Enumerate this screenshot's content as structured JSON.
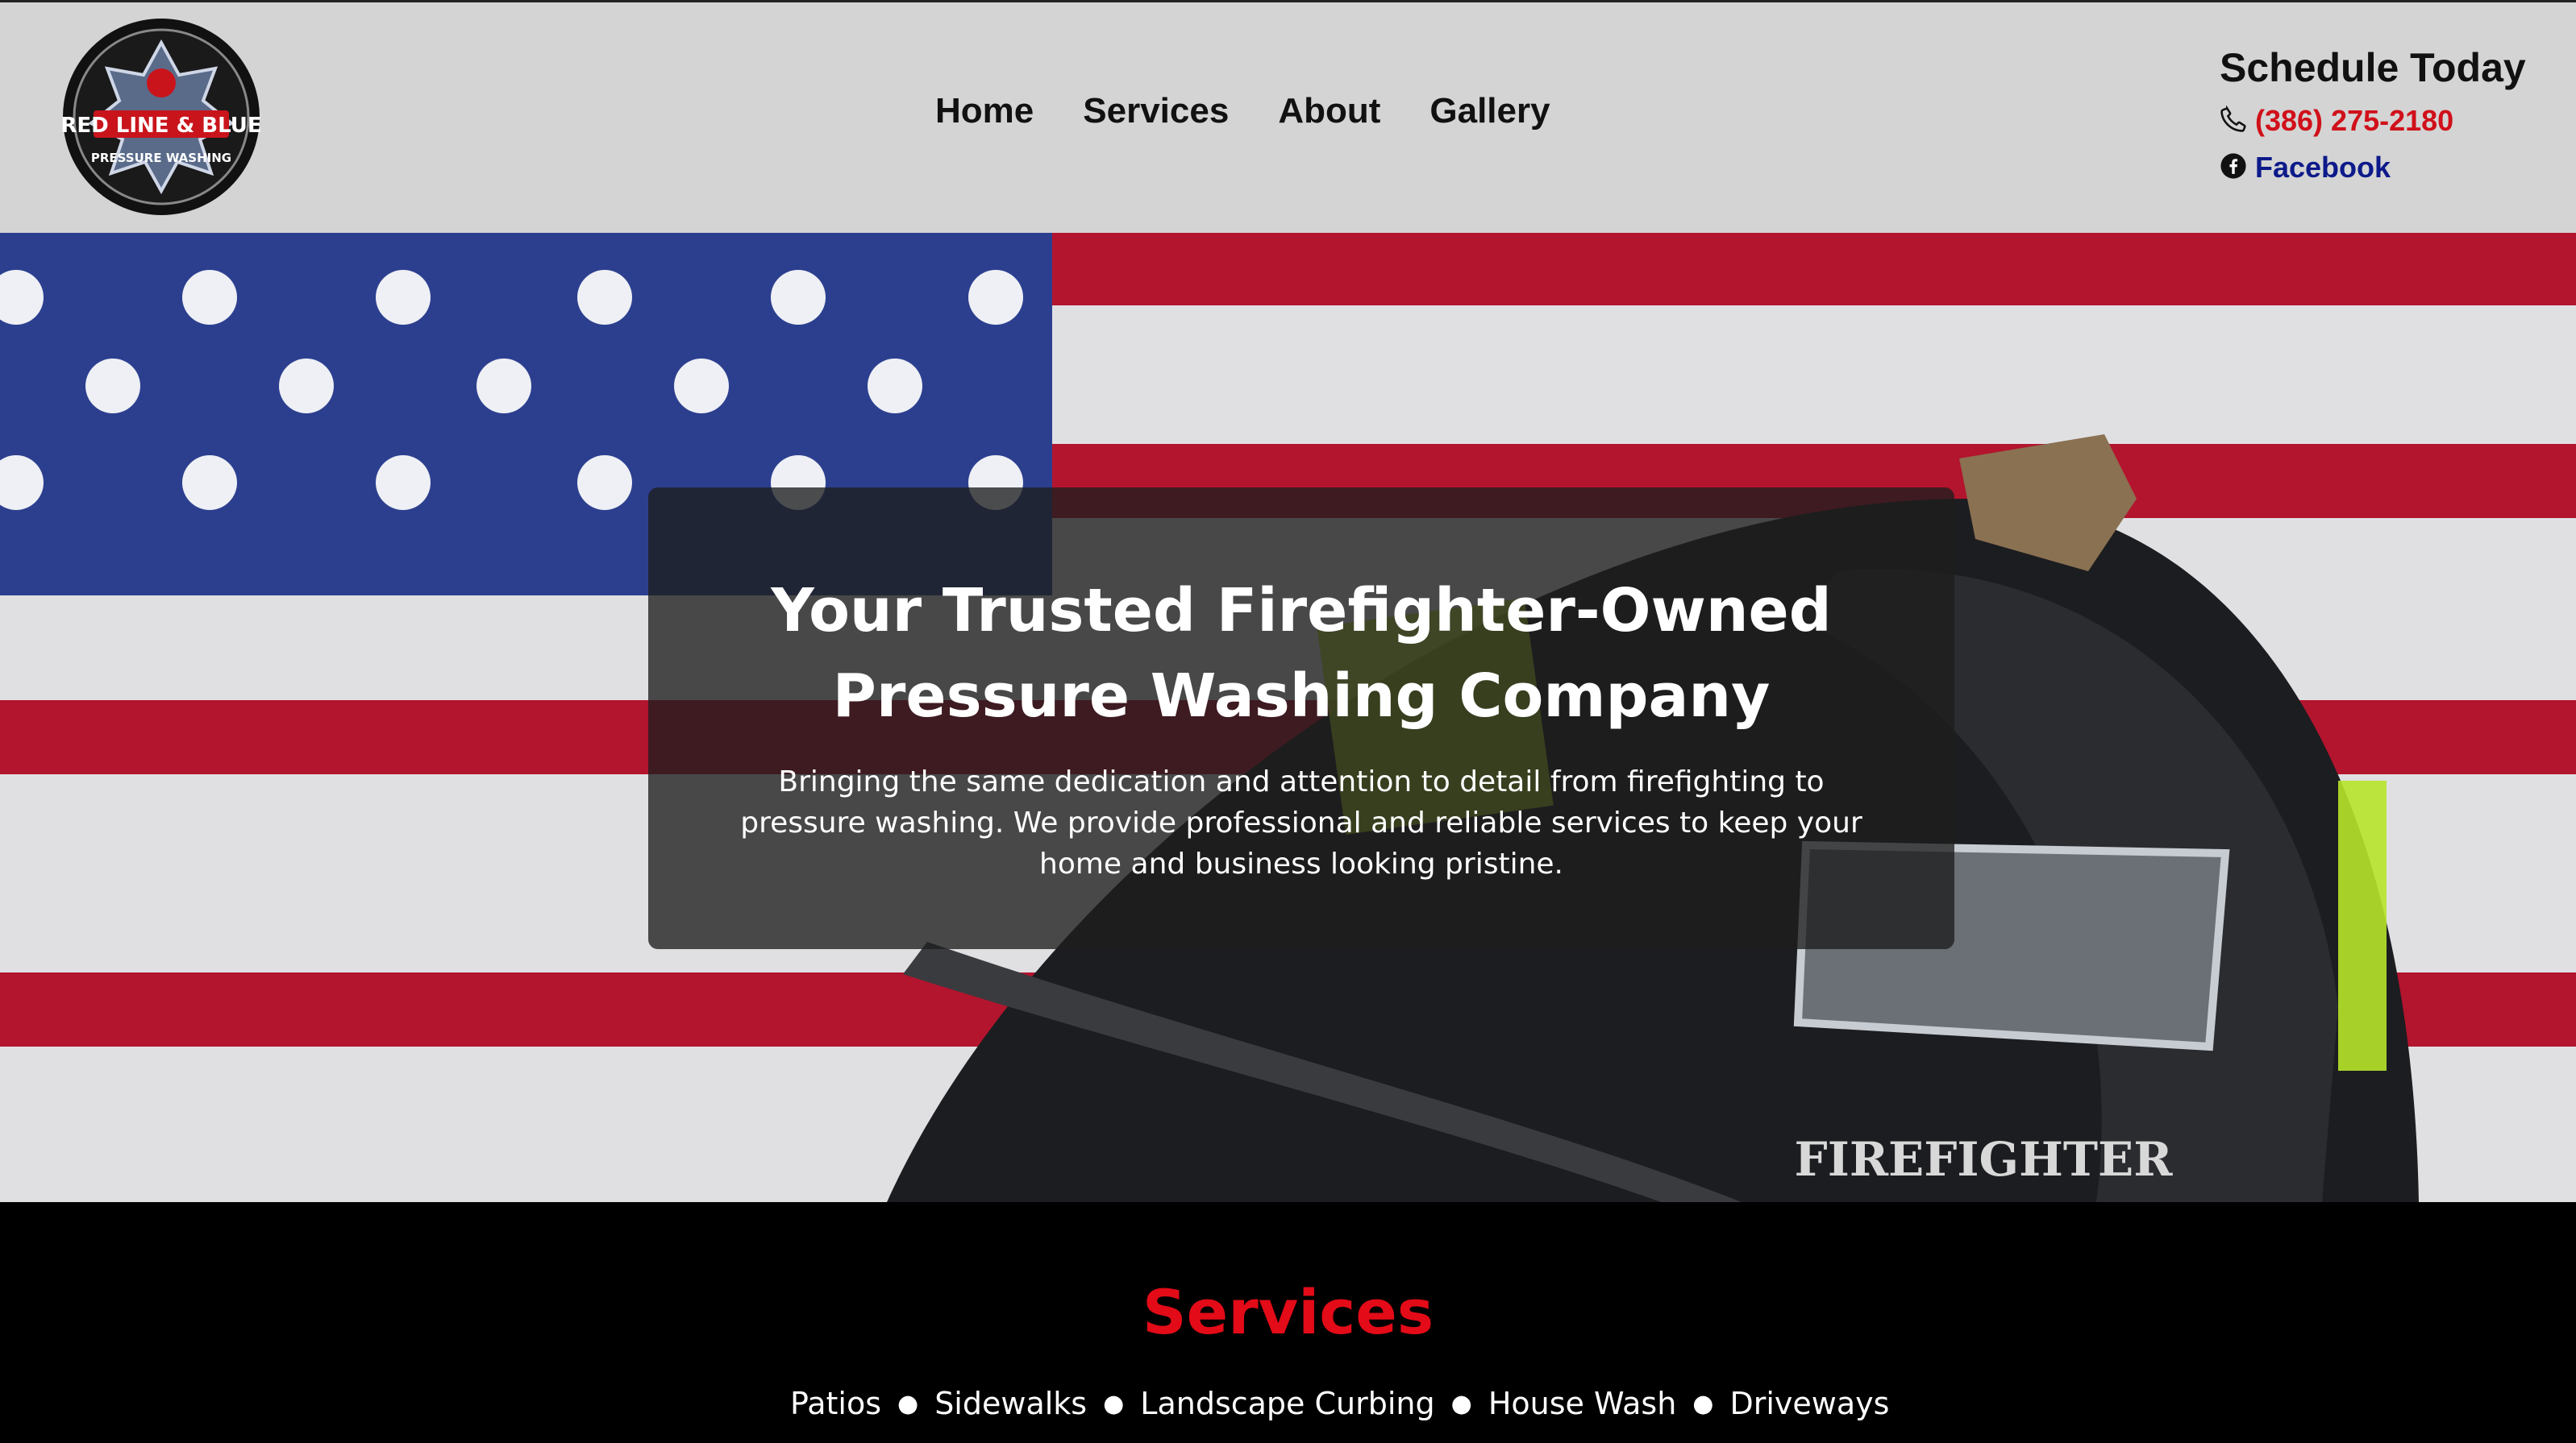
{
  "header": {
    "logo": {
      "line1": "RED LINE & BLUE",
      "line2": "PRESSURE WASHING",
      "icon": "firefighter-crest-logo"
    },
    "nav": [
      "Home",
      "Services",
      "About",
      "Gallery"
    ],
    "contact": {
      "heading": "Schedule Today",
      "phone": "(386) 275-2180",
      "phone_icon": "phone-icon",
      "facebook": "Facebook",
      "facebook_icon": "facebook-icon"
    }
  },
  "hero": {
    "title_line1": "Your Trusted Firefighter-Owned",
    "title_line2": "Pressure Washing Company",
    "subtitle": "Bringing the same dedication and attention to detail from firefighting to pressure washing. We provide professional and reliable services to keep your home and business looking pristine.",
    "helmet_text": "FIREFIGHTER"
  },
  "services": {
    "title": "Services",
    "items": [
      "Patios",
      "Sidewalks",
      "Landscape Curbing",
      "House Wash",
      "Driveways"
    ]
  },
  "colors": {
    "header_bg": "#d4d4d4",
    "accent_red": "#e30b17",
    "phone_red": "#d0101a",
    "facebook_blue": "#0d1a8a",
    "flag_red": "#b3142e",
    "flag_blue": "#2c3f8f"
  }
}
